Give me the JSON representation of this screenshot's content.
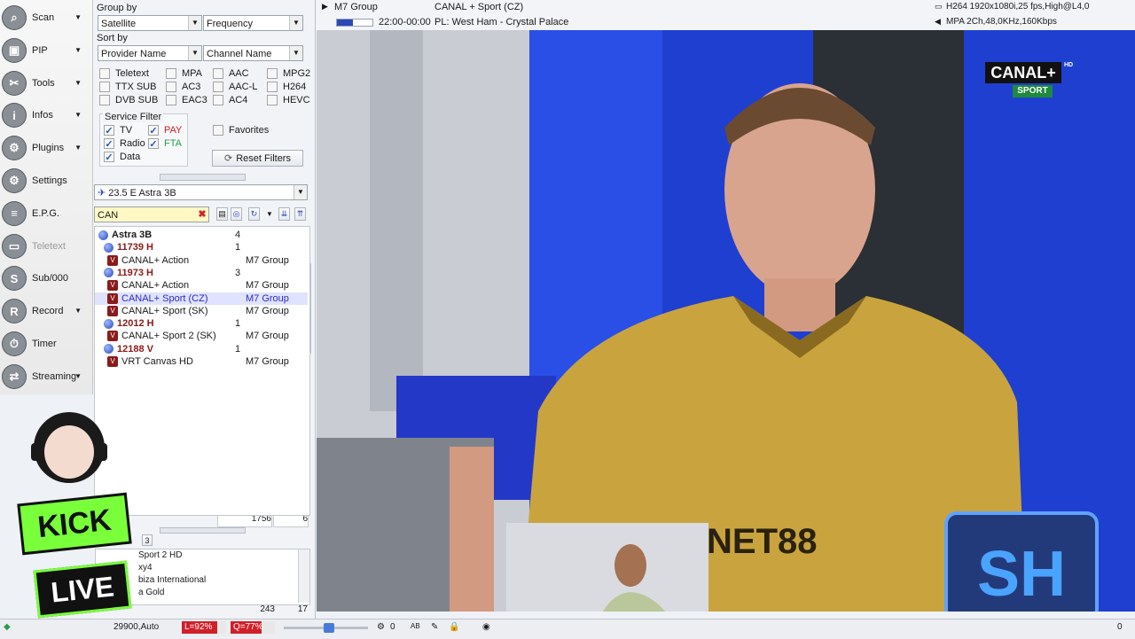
{
  "nav": {
    "items": [
      {
        "label": "Scan",
        "arrow": true
      },
      {
        "label": "PIP",
        "arrow": true
      },
      {
        "label": "Tools",
        "arrow": true
      },
      {
        "label": "Infos",
        "arrow": true
      },
      {
        "label": "Plugins",
        "arrow": true
      },
      {
        "label": "Settings",
        "arrow": false
      },
      {
        "label": "E.P.G.",
        "arrow": false
      },
      {
        "label": "Teletext",
        "arrow": false
      },
      {
        "label": "Sub/000",
        "arrow": false
      },
      {
        "label": "Record",
        "arrow": true
      },
      {
        "label": "Timer",
        "arrow": false
      },
      {
        "label": "Streaming",
        "arrow": true
      }
    ]
  },
  "filter": {
    "group_by_label": "Group by",
    "group_by_value": "Satellite",
    "group_by_value2": "Frequency",
    "sort_by_label": "Sort by",
    "sort_by_value": "Provider Name",
    "sort_by_value2": "Channel Name",
    "checks_col1": [
      "Teletext",
      "TTX SUB",
      "DVB SUB"
    ],
    "checks_col2": [
      "MPA",
      "AC3",
      "EAC3"
    ],
    "checks_col3": [
      "AAC",
      "AAC-L",
      "AC4"
    ],
    "checks_col4": [
      "MPG2",
      "H264",
      "HEVC"
    ],
    "service_filter_label": "Service Filter",
    "service_tv": "TV",
    "service_pay": "PAY",
    "service_radio": "Radio",
    "service_fta": "FTA",
    "service_data": "Data",
    "favorites": "Favorites",
    "reset_filters": "Reset Filters",
    "satellite_select": "23.5 E Astra 3B",
    "search_value": "CAN"
  },
  "tree": {
    "rows": [
      {
        "type": "sat",
        "label": "Astra 3B",
        "count": "4"
      },
      {
        "type": "tp",
        "label": "11739 H",
        "count": "1"
      },
      {
        "type": "ch",
        "label": "CANAL+ Action",
        "provider": "M7 Group"
      },
      {
        "type": "tp",
        "label": "11973 H",
        "count": "3"
      },
      {
        "type": "ch",
        "label": "CANAL+ Action",
        "provider": "M7 Group"
      },
      {
        "type": "ch",
        "label": "CANAL+ Sport (CZ)",
        "provider": "M7 Group",
        "selected": true
      },
      {
        "type": "ch",
        "label": "CANAL+ Sport (SK)",
        "provider": "M7 Group"
      },
      {
        "type": "tp",
        "label": "12012 H",
        "count": "1"
      },
      {
        "type": "ch",
        "label": "CANAL+ Sport 2 (SK)",
        "provider": "M7 Group"
      },
      {
        "type": "tp",
        "label": "12188 V",
        "count": "1"
      },
      {
        "type": "ch",
        "label": "VRT Canvas HD",
        "provider": "M7 Group"
      }
    ],
    "footer_count1": "1756",
    "footer_count2": "6"
  },
  "mini_list": {
    "tab": "3",
    "items": [
      "Sport 2 HD",
      "xy4",
      "biza International",
      "a Gold"
    ],
    "footer1": "243",
    "footer2": "17"
  },
  "header": {
    "provider": "M7 Group",
    "channel": "CANAL + Sport (CZ)",
    "time": "22:00-00:00",
    "program": "PL: West Ham - Crystal Palace",
    "video_info": "H264 1920x1080i,25 fps,High@L4,0",
    "audio_info": "MPA 2Ch,48,0KHz,160Kbps"
  },
  "status": {
    "tp": "29900,Auto",
    "level": "L=92%",
    "quality": "Q=77%",
    "cc": "0",
    "ab": "AB",
    "right": "0"
  },
  "overlay": {
    "channel_logo": "CANAL+",
    "channel_sub": "SPORT",
    "hd": "HD",
    "sponsor": "NET88",
    "stream_kick": "KICK",
    "stream_live": "LIVE",
    "stream_sh": "SH"
  },
  "colors": {
    "accent": "#2b48b8",
    "pay": "#d0202a",
    "fta": "#2a9d4a",
    "jersey": "#c9a43e"
  }
}
